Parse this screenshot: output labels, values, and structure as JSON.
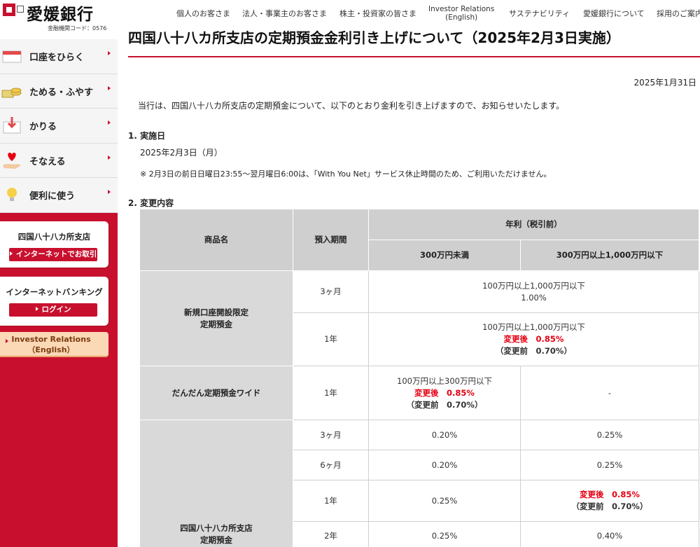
{
  "logo": {
    "name": "愛媛銀行",
    "code": "金融機関コード：0576"
  },
  "sidebar": {
    "items": [
      {
        "label": "口座をひらく",
        "icon": "bankbook-icon"
      },
      {
        "label": "ためる・ふやす",
        "icon": "coins-icon"
      },
      {
        "label": "かりる",
        "icon": "envelope-money-icon"
      },
      {
        "label": "そなえる",
        "icon": "heart-hand-icon"
      },
      {
        "label": "便利に使う",
        "icon": "lightbulb-icon"
      }
    ],
    "branch_card": {
      "title": "四国八十八カ所支店",
      "button": "インターネットでお取引"
    },
    "ib_card": {
      "title": "インターネットバンキング",
      "button": "ログイン"
    },
    "ir": {
      "line1": "Investor Relations",
      "line2": "（English）"
    }
  },
  "topnav": {
    "items": [
      "個人のお客さま",
      "法人・事業主のお客さま",
      "株主・投資家の皆さま"
    ],
    "ir_line1": "Investor Relations",
    "ir_line2": "(English)",
    "items2": [
      "サステナビリティ",
      "愛媛銀行について",
      "採用のご案内"
    ]
  },
  "page": {
    "title": "四国八十八カ所支店の定期預金金利引き上げについて（2025年2月3日実施）",
    "date": "2025年1月31日",
    "intro": "当行は、四国八十八カ所支店の定期預金について、以下のとおり金利を引き上げますので、お知らせいたします。",
    "sec1_heading": "1. 実施日",
    "sec1_date": "2025年2月3日（月）",
    "sec1_note": "※ 2月3日の前日日曜日23:55～翌月曜日6:00は、「With You Net」サービス休止時間のため、ご利用いただけません。",
    "sec2_heading": "2. 変更内容"
  },
  "table": {
    "headers": {
      "product": "商品名",
      "term": "預入期間",
      "rate": "年利（税引前）",
      "col1": "300万円未満",
      "col2": "300万円以上1,000万円以下"
    },
    "rows": {
      "p1_name1": "新規口座開設限定",
      "p1_name2": "定期預金",
      "p1_r1_term": "3ヶ月",
      "p1_r1_range": "100万円以上1,000万円以下",
      "p1_r1_rate": "1.00%",
      "p1_r2_term": "1年",
      "p1_r2_range": "100万円以上1,000万円以下",
      "p1_r2_after": "変更後　0.85%",
      "p1_r2_before": "（変更前　0.70%）",
      "p2_name": "だんだん定期預金ワイド",
      "p2_term": "1年",
      "p2_range": "100万円以上300万円以下",
      "p2_after": "変更後　0.85%",
      "p2_before": "（変更前　0.70%）",
      "p2_col2": "-",
      "p3_name1": "四国八十八カ所支店",
      "p3_name2": "定期預金",
      "p3_r1_term": "3ヶ月",
      "p3_r1_c1": "0.20%",
      "p3_r1_c2": "0.25%",
      "p3_r2_term": "6ヶ月",
      "p3_r2_c1": "0.20%",
      "p3_r2_c2": "0.25%",
      "p3_r3_term": "1年",
      "p3_r3_c1": "0.25%",
      "p3_r3_after": "変更後　0.85%",
      "p3_r3_before": "（変更前　0.70%）",
      "p3_r4_term": "2年",
      "p3_r4_c1": "0.25%",
      "p3_r4_c2": "0.40%"
    }
  },
  "colors": {
    "brand": "#c8102e",
    "highlight": "#e60012"
  }
}
